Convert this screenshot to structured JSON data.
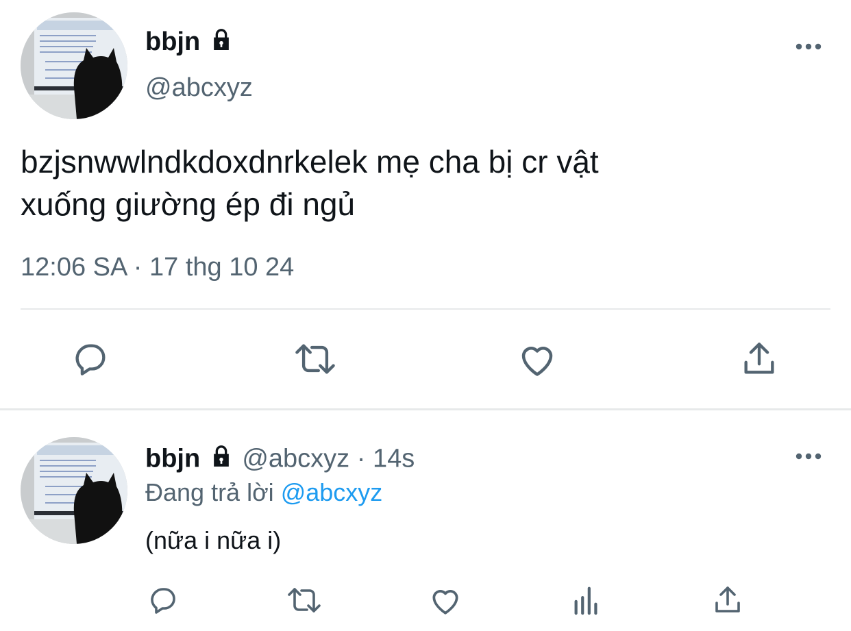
{
  "main_tweet": {
    "display_name": "bbjn",
    "handle": "@abcxyz",
    "text_line1": "bzjsnwwlndkdoxdnrkelek mẹ cha bị cr vật",
    "text_line2": "xuống giường ép đi ngủ",
    "timestamp": "12:06 SA · 17 thg 10 24"
  },
  "reply_tweet": {
    "display_name": "bbjn",
    "handle": "@abcxyz",
    "time_sep": "·",
    "time_ago": "14s",
    "replying_prefix": "Đang trả lời",
    "replying_to": "@abcxyz",
    "text": "(nữa i nữa i)"
  },
  "icons": {
    "lock": "lock-icon",
    "more": "more-icon",
    "reply": "reply-icon",
    "retweet": "retweet-icon",
    "like": "heart-icon",
    "views": "views-icon",
    "share": "share-icon"
  },
  "colors": {
    "text": "#0f1419",
    "muted": "#536471",
    "link": "#1d9bf0",
    "divider": "#e7e9ea"
  }
}
